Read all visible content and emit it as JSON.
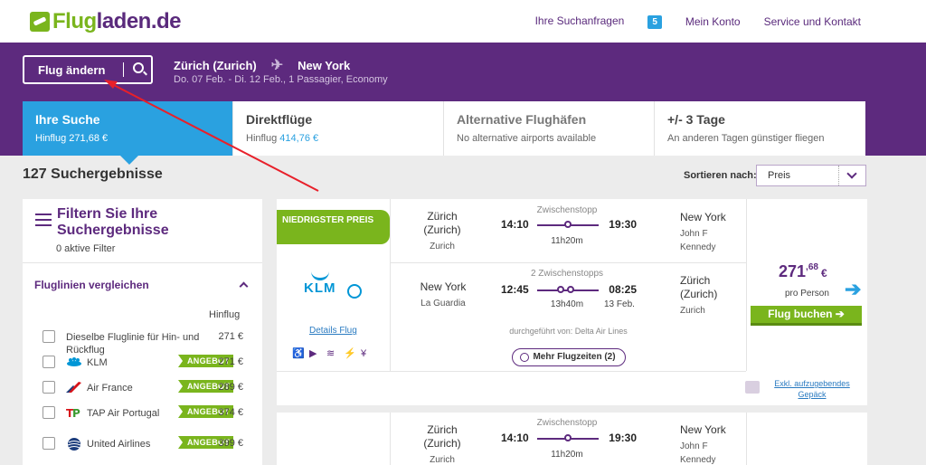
{
  "header": {
    "logo_text_prefix": "Flug",
    "logo_text_suffix": "laden.de",
    "nav": {
      "requests_label": "Ihre Suchanfragen",
      "requests_count": "5",
      "account_label": "Mein Konto",
      "service_label": "Service und Kontakt"
    },
    "brand_colors": {
      "purple": "#5d2a7e",
      "green": "#7ab51d",
      "blue": "#2aa1e0"
    }
  },
  "search": {
    "change_label": "Flug ändern",
    "from": "Zürich (Zurich)",
    "to": "New York",
    "details": "Do. 07 Feb. - Di. 12 Feb., 1 Passagier, Economy"
  },
  "tabs": [
    {
      "title": "Ihre Suche",
      "sub_prefix": "Hinflug 271,68 €",
      "sub_value": ""
    },
    {
      "title": "Direktflüge",
      "sub_prefix": "Hinflug ",
      "sub_value": "414,76 €"
    },
    {
      "title": "Alternative Flughäfen",
      "sub_prefix": "No alternative airports available",
      "sub_value": ""
    },
    {
      "title": "+/- 3 Tage",
      "sub_prefix": "An anderen Tagen günstiger fliegen",
      "sub_value": ""
    }
  ],
  "results": {
    "count_label": "127 Suchergebnisse",
    "sort_label": "Sortieren nach:",
    "sort_value": "Preis"
  },
  "filter": {
    "title": "Filtern Sie Ihre Suchergebnisse",
    "active": "0 aktive Filter",
    "airline_section": "Fluglinien vergleichen",
    "hinflug_header": "Hinflug",
    "same_airline": "Dieselbe Fluglinie für Hin- und Rückflug",
    "same_airline_price": "271 €",
    "offer_label": "ANGEBOT",
    "airlines": [
      {
        "name": "KLM",
        "price": "271 €",
        "icon": "klm-crown-icon"
      },
      {
        "name": "Air France",
        "price": "289 €",
        "icon": "air-france-icon"
      },
      {
        "name": "TAP Air Portugal",
        "price": "374 €",
        "icon": "tap-icon"
      },
      {
        "name": "United Airlines",
        "price": "399 €",
        "icon": "united-globe-icon"
      }
    ]
  },
  "card": {
    "ribbon": "NIEDRIGSTER PREIS",
    "airline_logo": "KLM",
    "details_link": "Details Flug",
    "outbound": {
      "from_city": "Zürich (Zurich)",
      "from_airport": "Zurich",
      "stops": "Zwischenstopp",
      "dep": "14:10",
      "arr": "19:30",
      "duration": "11h20m",
      "to_city": "New York",
      "to_airport": "John F Kennedy"
    },
    "inbound": {
      "from_city": "New York",
      "from_airport": "La Guardia",
      "stops": "2 Zwischenstopps",
      "dep": "12:45",
      "arr": "08:25",
      "duration": "13h40m",
      "next_day": "13 Feb.",
      "to_city": "Zürich (Zurich)",
      "to_airport": "Zurich"
    },
    "operated_by": "durchgeführt von: Delta Air Lines",
    "more_times": "Mehr Flugzeiten (2)",
    "price_main": "271",
    "price_cents": ",68",
    "price_currency": "€",
    "per_person": "pro Person",
    "book_label": "Flug buchen ➔",
    "luggage_note": "Exkl. aufzugebendes Gepäck"
  },
  "card2": {
    "from_city": "Zürich (Zurich)",
    "from_airport": "Zurich",
    "stops": "Zwischenstopp",
    "dep": "14:10",
    "arr": "19:30",
    "duration": "11h20m",
    "to_city": "New York",
    "to_airport": "John F Kennedy"
  }
}
